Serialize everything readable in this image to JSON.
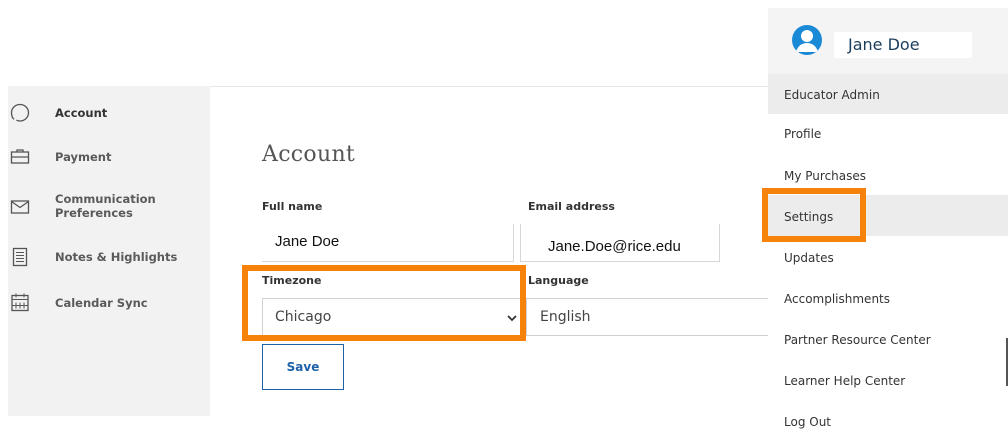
{
  "sidebar": {
    "items": [
      {
        "label": "Account",
        "icon": "account-icon",
        "active": true
      },
      {
        "label": "Payment",
        "icon": "payment-icon"
      },
      {
        "label": "Communication Preferences",
        "icon": "mail-icon"
      },
      {
        "label": "Notes & Highlights",
        "icon": "notes-icon"
      },
      {
        "label": "Calendar Sync",
        "icon": "calendar-icon"
      }
    ]
  },
  "main": {
    "title": "Account",
    "full_name": {
      "label": "Full name",
      "value": "Jane Doe"
    },
    "email": {
      "label": "Email address",
      "value": "Jane.Doe@rice.edu"
    },
    "timezone": {
      "label": "Timezone",
      "value": "Chicago"
    },
    "language": {
      "label": "Language",
      "value": "English"
    },
    "save_label": "Save"
  },
  "user_menu": {
    "user_name": "Jane Doe",
    "items": [
      {
        "label": "Educator Admin"
      },
      {
        "label": "Profile"
      },
      {
        "label": "My Purchases"
      },
      {
        "label": "Settings"
      },
      {
        "label": "Updates"
      },
      {
        "label": "Accomplishments"
      },
      {
        "label": "Partner Resource Center"
      },
      {
        "label": "Learner Help Center"
      },
      {
        "label": "Log Out"
      }
    ]
  },
  "colors": {
    "highlight": "#f7820b",
    "accent": "#1d62a8",
    "avatar": "#1b8ad6"
  }
}
